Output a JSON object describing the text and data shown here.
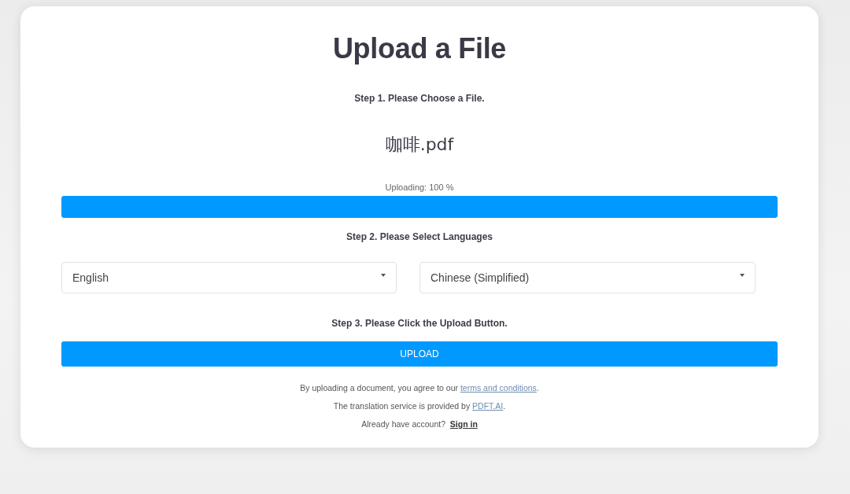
{
  "title": "Upload a File",
  "step1": {
    "label": "Step 1. Please Choose a File.",
    "file_name": "咖啡.pdf",
    "status": "Uploading: 100 %",
    "progress": {
      "level": 1
    }
  },
  "step2": {
    "label": "Step 2. Please Select Languages",
    "selects": [
      {
        "value": "English"
      },
      {
        "value": "Chinese (Simplified)"
      }
    ]
  },
  "step3": {
    "label": "Step 3. Please Click the Upload Button.",
    "button": "UPLOAD"
  },
  "footer": [
    {
      "kind": "notice",
      "text": "By uploading a document, you agree to our ",
      "link": "terms and conditions",
      "after": "."
    },
    {
      "kind": "notice",
      "text": "The translation service is provided by ",
      "link": "PDFT.AI",
      "after": "."
    },
    {
      "kind": "prompt",
      "text": "Already have account?  ",
      "link": "Sign in"
    }
  ]
}
